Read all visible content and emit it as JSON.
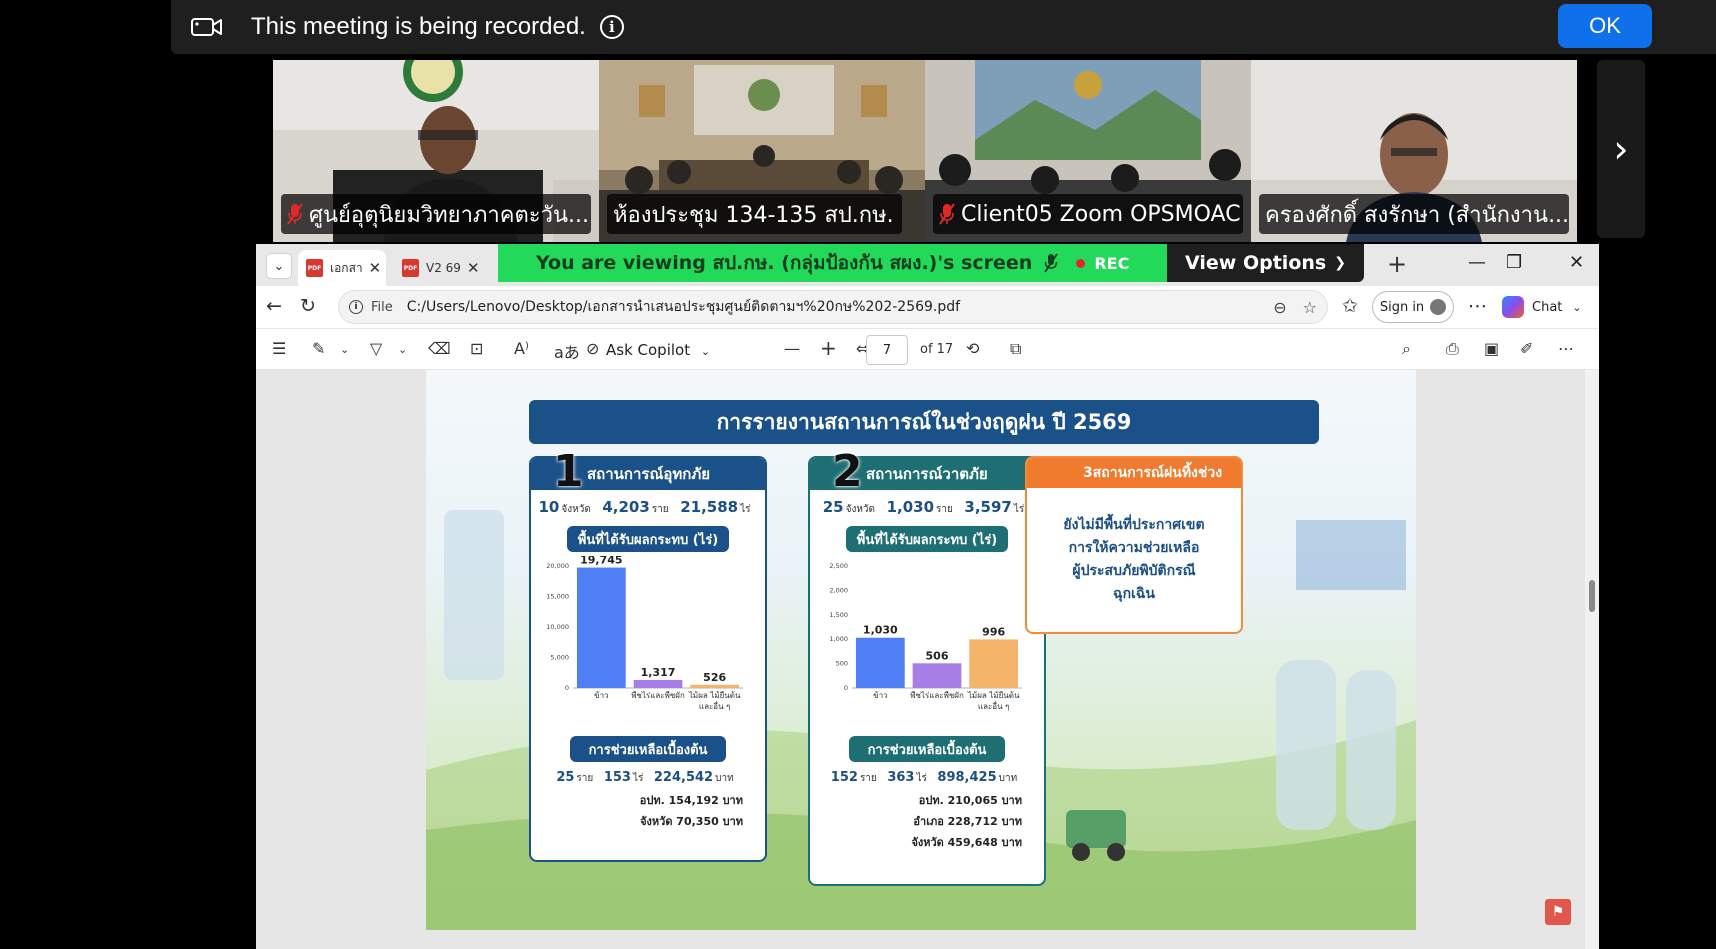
{
  "recording_banner": {
    "message": "This meeting is being recorded.",
    "ok_label": "OK"
  },
  "gallery": {
    "tiles": [
      {
        "name": "ศูนย์อุตุนิยมวิทยาภาคตะวัน...",
        "muted": true
      },
      {
        "name": "ห้องประชุม 134-135 สป.กษ.",
        "muted": false
      },
      {
        "name": "Client05 Zoom OPSMOAC",
        "muted": true
      },
      {
        "name": "ครองศักดิ์ สงรักษา (สำนักงาน...",
        "muted": false,
        "active": true
      }
    ],
    "next_icon": "chevron-right-icon"
  },
  "share_bar": {
    "viewing_text": "You are viewing  สป.กษ. (กลุ่มป้องกัน สผง.)'s screen",
    "rec_label": "REC",
    "view_options_label": "View Options"
  },
  "browser": {
    "tabs": [
      {
        "label": "เอกสา",
        "icon_label": "PDF"
      },
      {
        "label": "V2 69",
        "icon_label": "PDF"
      }
    ],
    "pdf_icon_label": "PDF",
    "url_scheme": "File",
    "url": "C:/Users/Lenovo/Desktop/เอกสารนำเสนอประชุมศูนย์ติดตามฯ%20กษ%202-2569.pdf",
    "sign_in_label": "Sign in",
    "chat_label": "Chat"
  },
  "pdf_toolbar": {
    "ask_copilot_label": "Ask Copilot",
    "current_page": "7",
    "of_pages": "of 17",
    "read_aloud_label": "A⁾",
    "translate_label": "aあ"
  },
  "slide": {
    "title": "การรายงานสถานการณ์ในช่วงฤดูฝน ปี 2569",
    "panel1": {
      "number": "1",
      "heading": "สถานการณ์อุทกภัย",
      "stats": [
        {
          "value": "10",
          "unit": "จังหวัด"
        },
        {
          "value": "4,203",
          "unit": "ราย"
        },
        {
          "value": "21,588",
          "unit": "ไร่"
        }
      ],
      "chart_title": "พื้นที่ได้รับผลกระทบ (ไร่)",
      "assist_title": "การช่วยเหลือเบื้องต้น",
      "assist": [
        {
          "value": "25",
          "unit": "ราย"
        },
        {
          "value": "153",
          "unit": "ไร่"
        },
        {
          "value": "224,542",
          "unit": "บาท"
        }
      ],
      "sub_lines": [
        "อปท. 154,192 บาท",
        "จังหวัด 70,350 บาท"
      ]
    },
    "panel2": {
      "number": "2",
      "heading": "สถานการณ์วาตภัย",
      "stats": [
        {
          "value": "25",
          "unit": "จังหวัด"
        },
        {
          "value": "1,030",
          "unit": "ราย"
        },
        {
          "value": "3,597",
          "unit": "ไร่"
        }
      ],
      "chart_title": "พื้นที่ได้รับผลกระทบ (ไร่)",
      "assist_title": "การช่วยเหลือเบื้องต้น",
      "assist": [
        {
          "value": "152",
          "unit": "ราย"
        },
        {
          "value": "363",
          "unit": "ไร่"
        },
        {
          "value": "898,425",
          "unit": "บาท"
        }
      ],
      "sub_lines": [
        "อปท. 210,065 บาท",
        "อำเภอ 228,712 บาท",
        "จังหวัด 459,648 บาท"
      ]
    },
    "panel3": {
      "number": "3",
      "heading": "สถานการณ์ฝนทิ้งช่วง",
      "body_lines": [
        "ยังไม่มีพื้นที่ประกาศเขต",
        "การให้ความช่วยเหลือ",
        "ผู้ประสบภัยพิบัติกรณี",
        "ฉุกเฉิน"
      ]
    }
  },
  "chart_data": [
    {
      "type": "bar",
      "categories": [
        "ข้าว",
        "พืชไร่และพืชผัก",
        "ไม้ผล ไม้ยืนต้น และอื่น ๆ"
      ],
      "values": [
        19745,
        1317,
        526
      ],
      "value_labels": [
        "19,745",
        "1,317",
        "526"
      ],
      "yticks": [
        "0",
        "5,000",
        "10,000",
        "15,000",
        "20,000"
      ],
      "ylim": [
        0,
        20000
      ],
      "colors": [
        "#4f7ef5",
        "#a77ee6",
        "#f4b56a"
      ]
    },
    {
      "type": "bar",
      "categories": [
        "ข้าว",
        "พืชไร่และพืชผัก",
        "ไม้ผล ไม้ยืนต้น และอื่น ๆ"
      ],
      "values": [
        1030,
        506,
        996
      ],
      "value_labels": [
        "1,030",
        "506",
        "996"
      ],
      "yticks": [
        "0",
        "500",
        "1,000",
        "1,500",
        "2,000",
        "2,500"
      ],
      "ylim": [
        0,
        2500
      ],
      "colors": [
        "#4f7ef5",
        "#a77ee6",
        "#f4b56a"
      ]
    }
  ],
  "colors": {
    "zoom_blue": "#0e71eb",
    "zoom_green": "#23d959",
    "slide_navy": "#1b5189",
    "slide_orange": "#f07a2d",
    "slide_teal": "#1e6f73"
  }
}
